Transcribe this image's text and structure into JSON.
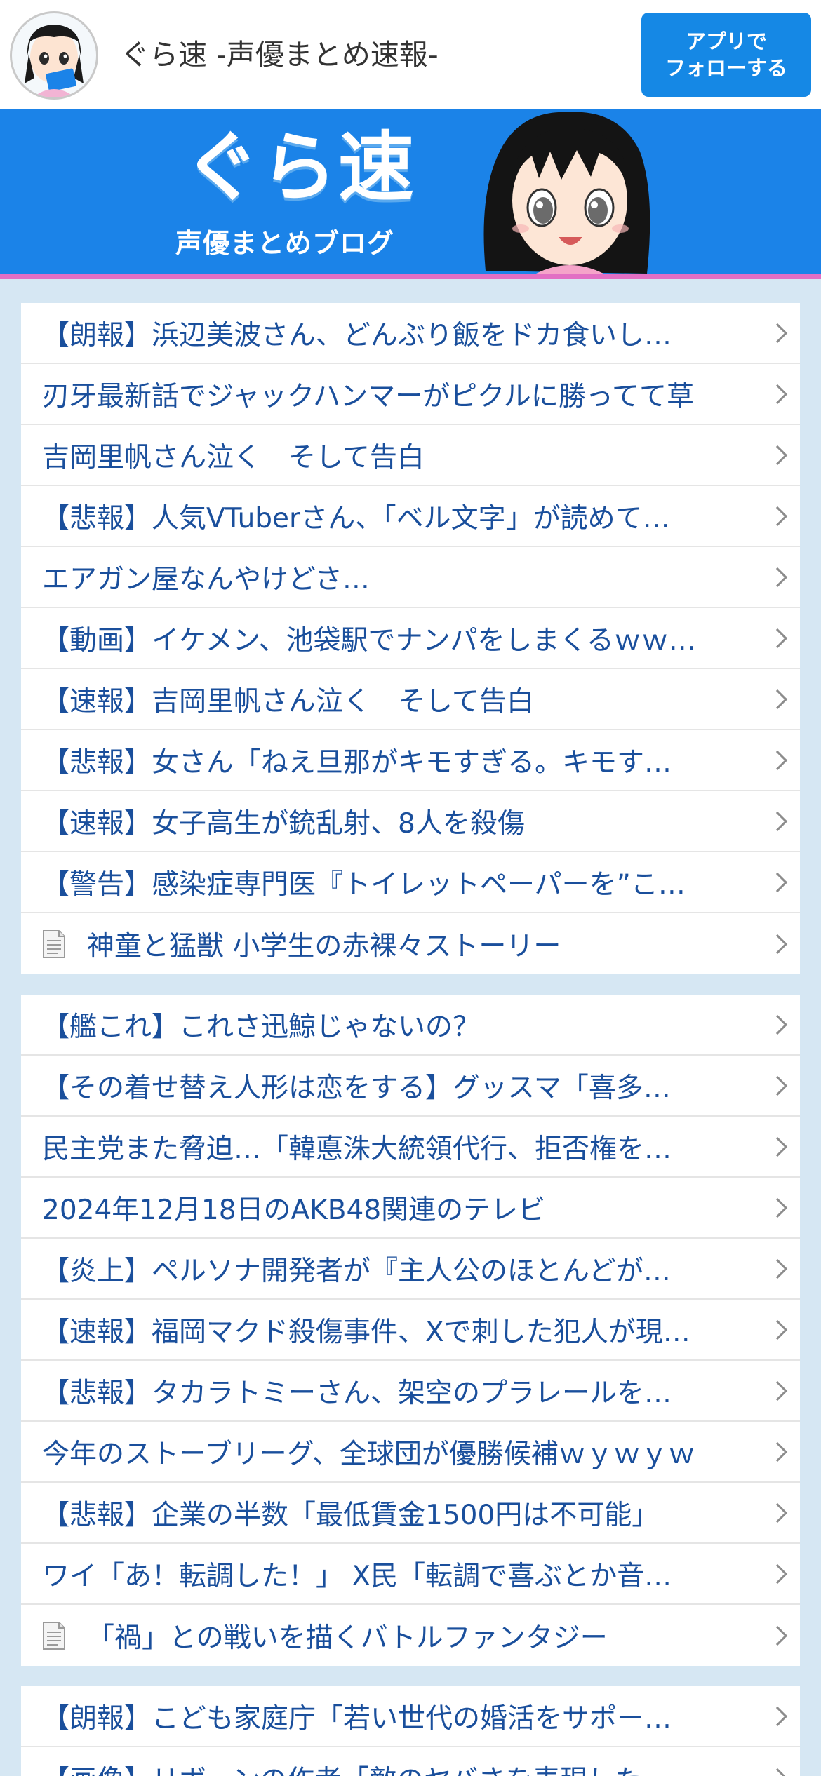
{
  "header": {
    "title": "ぐら速 -声優まとめ速報-",
    "follow_line1": "アプリで",
    "follow_line2": "フォローする"
  },
  "banner": {
    "logo": "ぐら速",
    "subtitle": "声優まとめブログ"
  },
  "colors": {
    "accent": "#1588e5",
    "banner_bg": "#1b83e8",
    "stripe": "#e26fc4",
    "link": "#1a4f9c",
    "page_bg": "#d6e7f3"
  },
  "section1": [
    {
      "text": "【朗報】浜辺美波さん、どんぶり飯をドカ食いし…",
      "icon": ""
    },
    {
      "text": "刃牙最新話でジャックハンマーがピクルに勝ってて草",
      "icon": ""
    },
    {
      "text": "吉岡里帆さん泣く　そして告白",
      "icon": ""
    },
    {
      "text": "【悲報】人気VTuberさん、「ベル文字」が読めて…",
      "icon": ""
    },
    {
      "text": "エアガン屋なんやけどさ…",
      "icon": ""
    },
    {
      "text": "【動画】イケメン、池袋駅でナンパをしまくるｗｗ…",
      "icon": ""
    },
    {
      "text": "【速報】吉岡里帆さん泣く　そして告白",
      "icon": ""
    },
    {
      "text": "【悲報】女さん「ねえ旦那がキモすぎる。キモす…",
      "icon": ""
    },
    {
      "text": "【速報】女子高生が銃乱射、8人を殺傷",
      "icon": ""
    },
    {
      "text": "【警告】感染症専門医『トイレットペーパーを”こ…",
      "icon": ""
    },
    {
      "text": "神童と猛獣 小学生の赤裸々ストーリー",
      "icon": "document-icon"
    }
  ],
  "section2": [
    {
      "text": "【艦これ】これさ迅鯨じゃないの？",
      "icon": ""
    },
    {
      "text": "【その着せ替え人形は恋をする】グッスマ「喜多…",
      "icon": ""
    },
    {
      "text": "民主党また脅迫…「韓悳洙大統領代行、拒否権を…",
      "icon": ""
    },
    {
      "text": "2024年12月18日のAKB48関連のテレビ",
      "icon": ""
    },
    {
      "text": "【炎上】ペルソナ開発者が『主人公のほとんどが…",
      "icon": ""
    },
    {
      "text": "【速報】福岡マクド殺傷事件、Xで刺した犯人が現…",
      "icon": ""
    },
    {
      "text": "【悲報】タカラトミーさん、架空のプラレールを…",
      "icon": ""
    },
    {
      "text": "今年のストーブリーグ、全球団が優勝候補ｗｙｗｙｗ",
      "icon": ""
    },
    {
      "text": "【悲報】企業の半数「最低賃金1500円は不可能」",
      "icon": ""
    },
    {
      "text": "ワイ「あ！転調した！」 X民「転調で喜ぶとか音…",
      "icon": ""
    },
    {
      "text": "「禍」との戦いを描くバトルファンタジー",
      "icon": "document-icon"
    }
  ],
  "section3": [
    {
      "text": "【朗報】こども家庭庁「若い世代の婚活をサポー…",
      "icon": ""
    },
    {
      "text": "【画像】リボーンの作者「敵のヤバさを表現した…",
      "icon": ""
    }
  ]
}
